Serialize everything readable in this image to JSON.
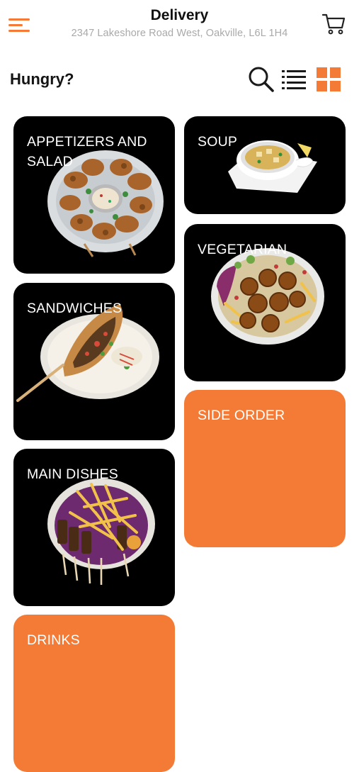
{
  "header": {
    "title": "Delivery",
    "address": "2347 Lakeshore Road West, Oakville, L6L 1H4",
    "menu_icon": "menu-icon",
    "cart_icon": "cart-icon"
  },
  "toolbar": {
    "greeting": "Hungry?",
    "search_icon": "search-icon",
    "list_icon": "list-view-icon",
    "grid_icon": "grid-view-icon",
    "active_view": "grid"
  },
  "categories": [
    {
      "label": "APPETIZERS AND SALAD",
      "style": "photo"
    },
    {
      "label": "SOUP",
      "style": "photo"
    },
    {
      "label": "VEGETARIAN",
      "style": "photo"
    },
    {
      "label": "SANDWICHES",
      "style": "photo"
    },
    {
      "label": "SIDE ORDER",
      "style": "plain"
    },
    {
      "label": "MAIN DISHES",
      "style": "photo"
    },
    {
      "label": "DRINKS",
      "style": "plain"
    }
  ],
  "colors": {
    "accent": "#f47b35",
    "card_dark": "#000000",
    "text_primary": "#111111",
    "text_secondary": "#a9a9a9"
  }
}
